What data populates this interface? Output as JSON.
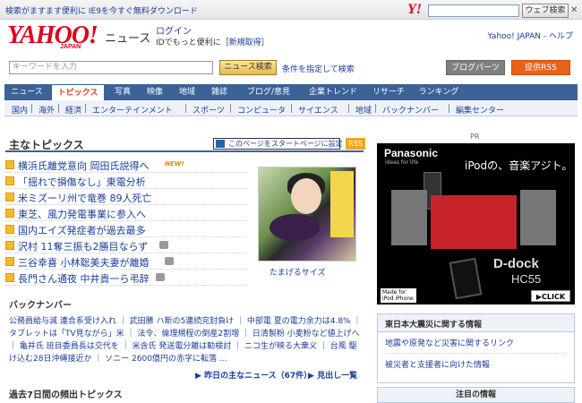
{
  "topbar": {
    "promo": "検索がますます便利に IE9を今すぐ無料ダウンロード",
    "logo_small": "Y!",
    "search_button": "ウェブ検索",
    "close": "✕"
  },
  "header": {
    "logo": "YAHOO!",
    "logo_sub": "JAPAN",
    "section": "ニュース",
    "login": "ログイン",
    "login_sub_prefix": "IDでもっと便利に［",
    "login_sub_link": "新規取得",
    "login_sub_suffix": "］",
    "help": "Yahoo! JAPAN - ヘルプ"
  },
  "search": {
    "placeholder": "キーワードを入力",
    "button": "ニュース検索",
    "advanced": "条件を指定して検索",
    "blogparts": "ブログパーツ",
    "rss": "提供RSS"
  },
  "nav": {
    "tabs": [
      {
        "label": "ニュース",
        "active": false
      },
      {
        "label": "トピックス",
        "active": true
      },
      {
        "label": "写真",
        "active": false
      },
      {
        "label": "映像",
        "active": false
      },
      {
        "label": "地域",
        "active": false
      },
      {
        "label": "雑誌",
        "active": false
      },
      {
        "label": "ブログ/意見",
        "active": false
      },
      {
        "label": "企業トレンド",
        "active": false
      },
      {
        "label": "リサーチ",
        "active": false
      },
      {
        "label": "ランキング",
        "active": false
      }
    ],
    "sub": [
      "国内",
      "海外",
      "経済",
      "エンターテインメント",
      "スポーツ",
      "コンピュータ",
      "サイエンス",
      "地域",
      "バックナンバー",
      "編集センター"
    ]
  },
  "main": {
    "title": "主なトピックス",
    "startpage": "このページをスタートページに設定",
    "rss": "RSS",
    "headlines": [
      {
        "text": "横浜氏離党意向 岡田氏説得へ",
        "badge": "NEW!"
      },
      {
        "text": "「揺れで損傷なし」東電分析",
        "badge": ""
      },
      {
        "text": "米ミズーリ州で竜巻 89人死亡",
        "badge": ""
      },
      {
        "text": "東芝、風力発電事業に参入へ",
        "badge": ""
      },
      {
        "text": "国内エイズ発症者が過去最多",
        "badge": ""
      },
      {
        "text": "沢村 11奪三振も2勝目ならず",
        "badge": "cam"
      },
      {
        "text": "三谷幸喜 小林聡美夫妻が離婚",
        "badge": "cam"
      },
      {
        "text": "長門さん通夜 中井貴一ら弔辞",
        "badge": "cam"
      }
    ],
    "photo_caption": "たまげるサイズ",
    "backnumber_title": "バックナンバー",
    "backnumber_text": "公務員給与減 連合系受け入れ ｜ 武田勝 ハ新の5連続完封負け ｜ 中部電 夏の電力余力は4.8% ｜ タブレットは「TV見ながら」米 ｜ 法令、倫理規程の倒産2割増 ｜ 日清製粉 小麦粉など値上げへ ｜ 亀井氏 班目委員長は交代を ｜ 米含氏 発送電分離は勧検討 ｜ ニコ生が映る大衆义 ｜ 台風 駆け込む28日沖縄接近か ｜ ソニー 2600億円の赤字に転落 ...",
    "yesterday": "昨日の主なニュース（67件）",
    "headlines_link": "見出し一覧",
    "past_title": "過去7日間の頻出トピックス"
  },
  "right": {
    "pr": "PR",
    "ad": {
      "brand": "Panasonic",
      "tagline": "ideas for life",
      "headline": "iPodの、音楽アジト。",
      "product": "D-dock",
      "model": "HC55",
      "compat": "Made for iPod iPhone",
      "click": "▶CLICK"
    },
    "quake": {
      "title": "東日本大震災に関する情報",
      "items": [
        "地震や原発など災害に関するリンク",
        "被災者と支援者に向けた情報"
      ]
    },
    "focus": "注目の情報"
  }
}
